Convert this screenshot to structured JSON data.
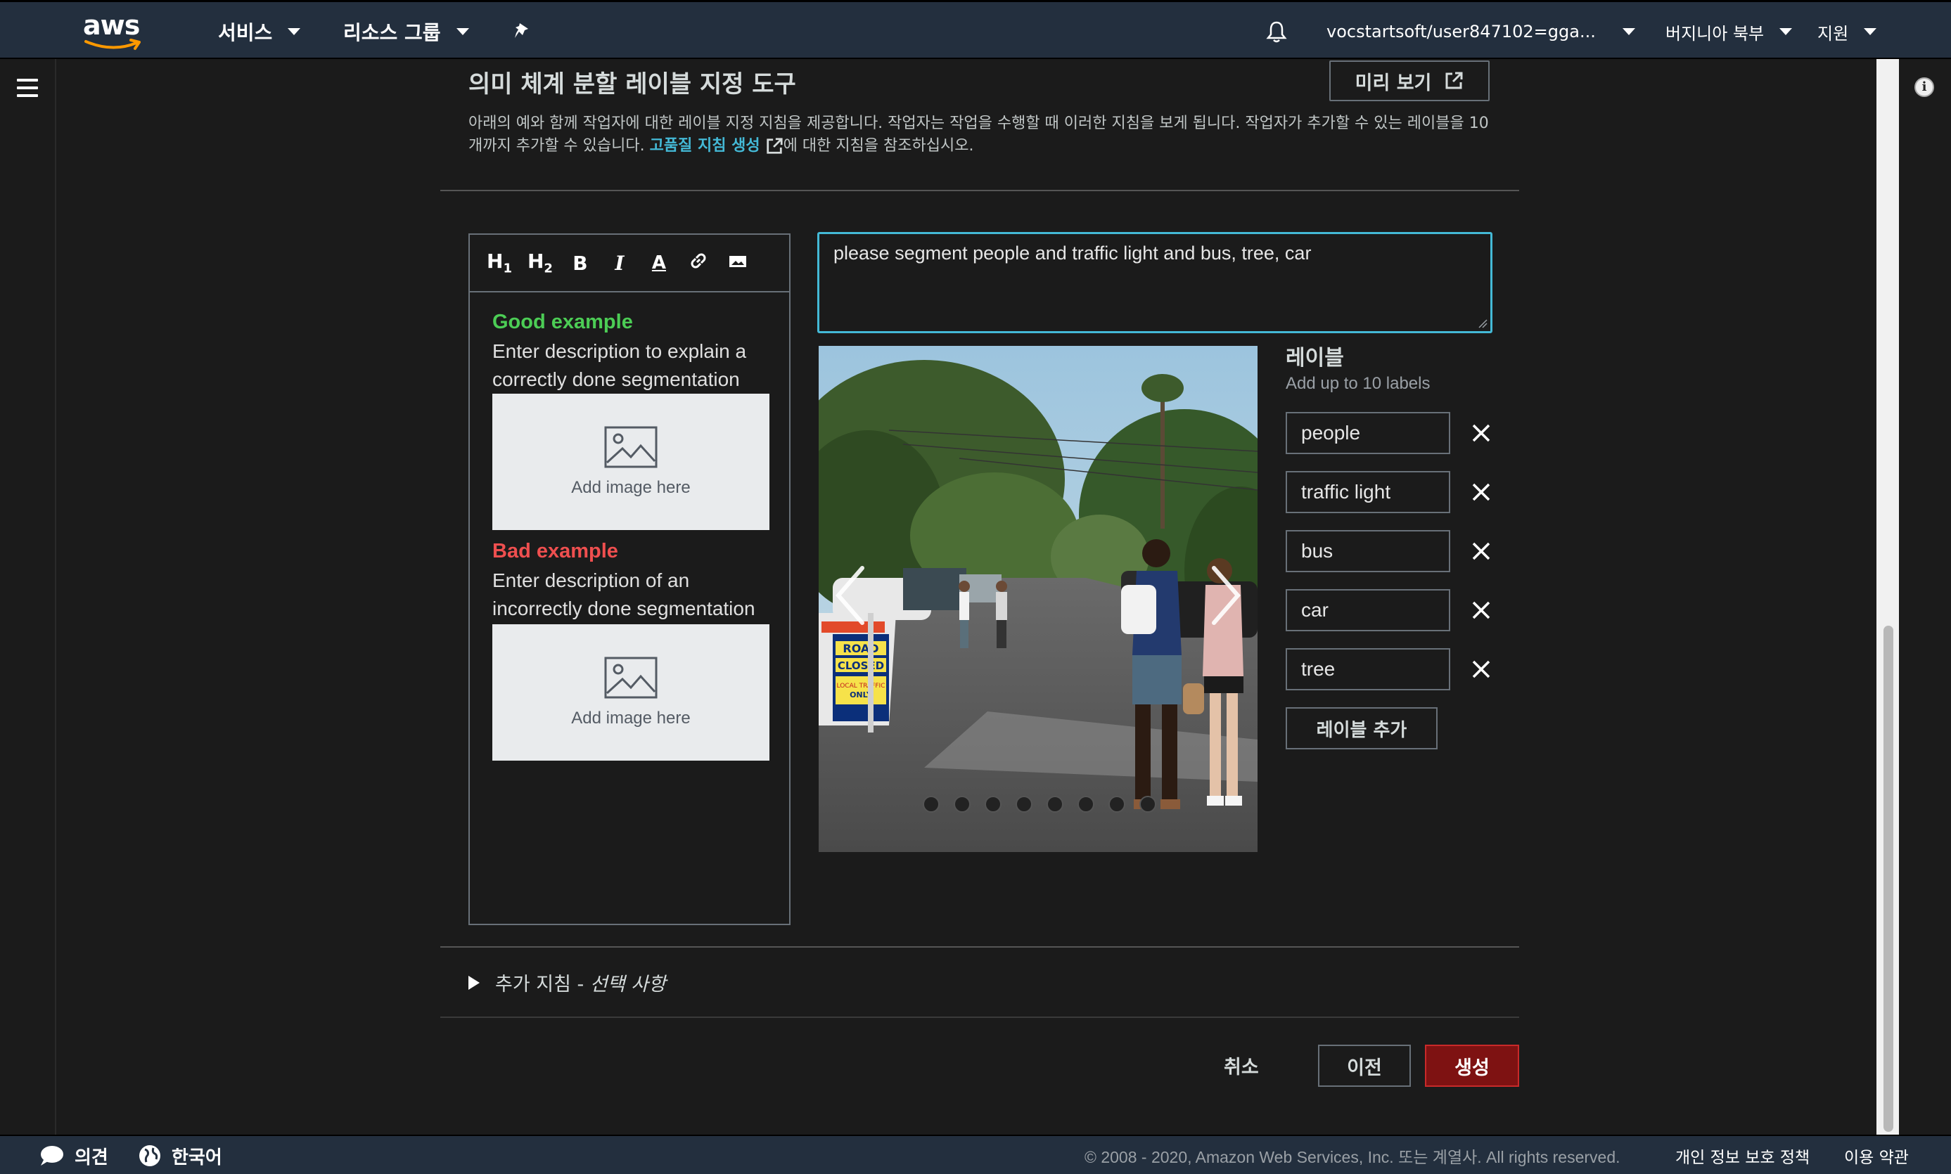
{
  "topnav": {
    "logo_text": "aws",
    "services": "서비스",
    "resource_groups": "리소스 그룹",
    "account": "vocstartsoft/user847102=gga...",
    "region": "버지니아 북부",
    "support": "지원"
  },
  "panel": {
    "title": "의미 체계 분할 레이블 지정 도구",
    "preview_button": "미리 보기",
    "desc_before": "아래의 예와 함께 작업자에 대한 레이블 지정 지침을 제공합니다. 작업자는 작업을 수행할 때 이러한 지침을 보게 됩니다. 작업자가 추가할 수 있는 레이블을 10개까지 추가할 수 있습니다. ",
    "desc_link": "고품질 지침 생성",
    "desc_after": "에 대한 지침을 참조하십시오."
  },
  "editor": {
    "toolbar": [
      "H1",
      "H2",
      "B",
      "I",
      "A"
    ],
    "good_title": "Good example",
    "good_desc": "Enter description to explain a correctly done segmentation",
    "bad_title": "Bad example",
    "bad_desc": "Enter description of an incorrectly done segmentation",
    "add_image": "Add image here",
    "good_color": "#4ccd55",
    "bad_color": "#ef4f4f"
  },
  "instruction_text": "please segment people and traffic light and bus, tree, car",
  "sign": {
    "line1": "ROAD",
    "line2": "CLOSED",
    "line3": "LOCAL TRAFFIC",
    "line4": "ONLY"
  },
  "labels": {
    "title": "레이블",
    "hint": "Add up to 10 labels",
    "items": [
      "people",
      "traffic light",
      "bus",
      "car",
      "tree"
    ],
    "add_button": "레이블 추가"
  },
  "extra": {
    "label": "추가 지침 - ",
    "optional": "선택 사항"
  },
  "actions": {
    "cancel": "취소",
    "previous": "이전",
    "create": "생성"
  },
  "footer": {
    "feedback": "의견",
    "language": "한국어",
    "copyright": "© 2008 - 2020, Amazon Web Services, Inc. 또는 계열사. All rights reserved.",
    "privacy": "개인 정보 보호 정책",
    "terms": "이용 약관"
  },
  "colors": {
    "accent": "#44b9d6",
    "create_button": "#7e1212",
    "nav_bg": "#232f3e"
  },
  "carousel": {
    "slide_count": 8
  }
}
